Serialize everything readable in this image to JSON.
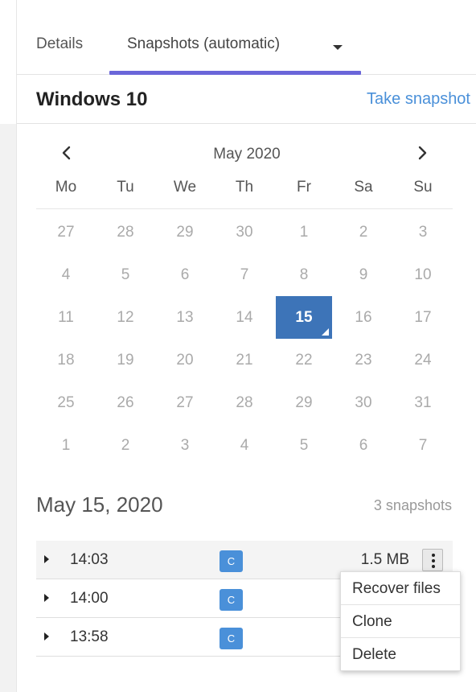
{
  "tabs": [
    {
      "label": "Details"
    },
    {
      "label": "Snapshots (automatic)"
    }
  ],
  "header": {
    "title": "Windows 10",
    "take_snapshot_label": "Take snapshot"
  },
  "calendar": {
    "month_label": "May 2020",
    "weekdays": [
      "Mo",
      "Tu",
      "We",
      "Th",
      "Fr",
      "Sa",
      "Su"
    ],
    "weeks": [
      [
        "27",
        "28",
        "29",
        "30",
        "1",
        "2",
        "3"
      ],
      [
        "4",
        "5",
        "6",
        "7",
        "8",
        "9",
        "10"
      ],
      [
        "11",
        "12",
        "13",
        "14",
        "15",
        "16",
        "17"
      ],
      [
        "18",
        "19",
        "20",
        "21",
        "22",
        "23",
        "24"
      ],
      [
        "25",
        "26",
        "27",
        "28",
        "29",
        "30",
        "31"
      ],
      [
        "1",
        "2",
        "3",
        "4",
        "5",
        "6",
        "7"
      ]
    ],
    "selected_day": "15"
  },
  "summary": {
    "selected_date": "May 15, 2020",
    "snapshot_count": "3 snapshots"
  },
  "snapshots": [
    {
      "time": "14:03",
      "badge": "C",
      "size": "1.5 MB"
    },
    {
      "time": "14:00",
      "badge": "C",
      "size": ""
    },
    {
      "time": "13:58",
      "badge": "C",
      "size": ""
    }
  ],
  "context_menu": {
    "items": [
      "Recover files",
      "Clone",
      "Delete"
    ]
  },
  "colors": {
    "accent_underline": "#6a66d9",
    "link": "#4a90d9",
    "selected_day_bg": "#3d74b8",
    "badge_bg": "#4a90d9"
  },
  "icons": {
    "prev": "chevron-left-icon",
    "next": "chevron-right-icon",
    "tab_dropdown": "caret-down-icon",
    "expander": "caret-right-icon",
    "more": "kebab-menu-icon"
  }
}
